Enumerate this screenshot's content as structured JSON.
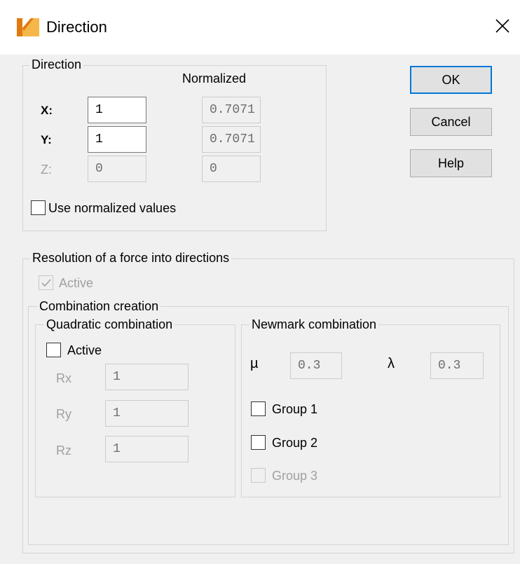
{
  "window": {
    "title": "Direction",
    "app_icon": "app-logo-icon",
    "close_icon": "close-icon"
  },
  "direction": {
    "group_label": "Direction",
    "normalized_header": "Normalized",
    "x": {
      "label": "X:",
      "value": "1",
      "normalized": "0.7071"
    },
    "y": {
      "label": "Y:",
      "value": "1",
      "normalized": "0.7071"
    },
    "z": {
      "label": "Z:",
      "value": "0",
      "normalized": "0"
    },
    "use_normalized": {
      "label": "Use normalized values",
      "checked": false
    }
  },
  "buttons": {
    "ok": "OK",
    "cancel": "Cancel",
    "help": "Help"
  },
  "resolution": {
    "group_label": "Resolution of a force into directions",
    "active": {
      "label": "Active",
      "checked": true,
      "disabled": true
    },
    "combination": {
      "group_label": "Combination creation",
      "quadratic": {
        "group_label": "Quadratic combination",
        "active": {
          "label": "Active",
          "checked": false
        },
        "rx": {
          "label": "Rx",
          "value": "1"
        },
        "ry": {
          "label": "Ry",
          "value": "1"
        },
        "rz": {
          "label": "Rz",
          "value": "1"
        }
      },
      "newmark": {
        "group_label": "Newmark combination",
        "mu": {
          "label": "µ",
          "value": "0.3"
        },
        "lambda": {
          "label": "λ",
          "value": "0.3"
        },
        "group1": {
          "label": "Group 1",
          "checked": false
        },
        "group2": {
          "label": "Group 2",
          "checked": false
        },
        "group3": {
          "label": "Group 3",
          "checked": false,
          "disabled": true
        }
      }
    }
  },
  "colors": {
    "accent_border": "#0078d7",
    "icon_orange": "#f0a030"
  }
}
